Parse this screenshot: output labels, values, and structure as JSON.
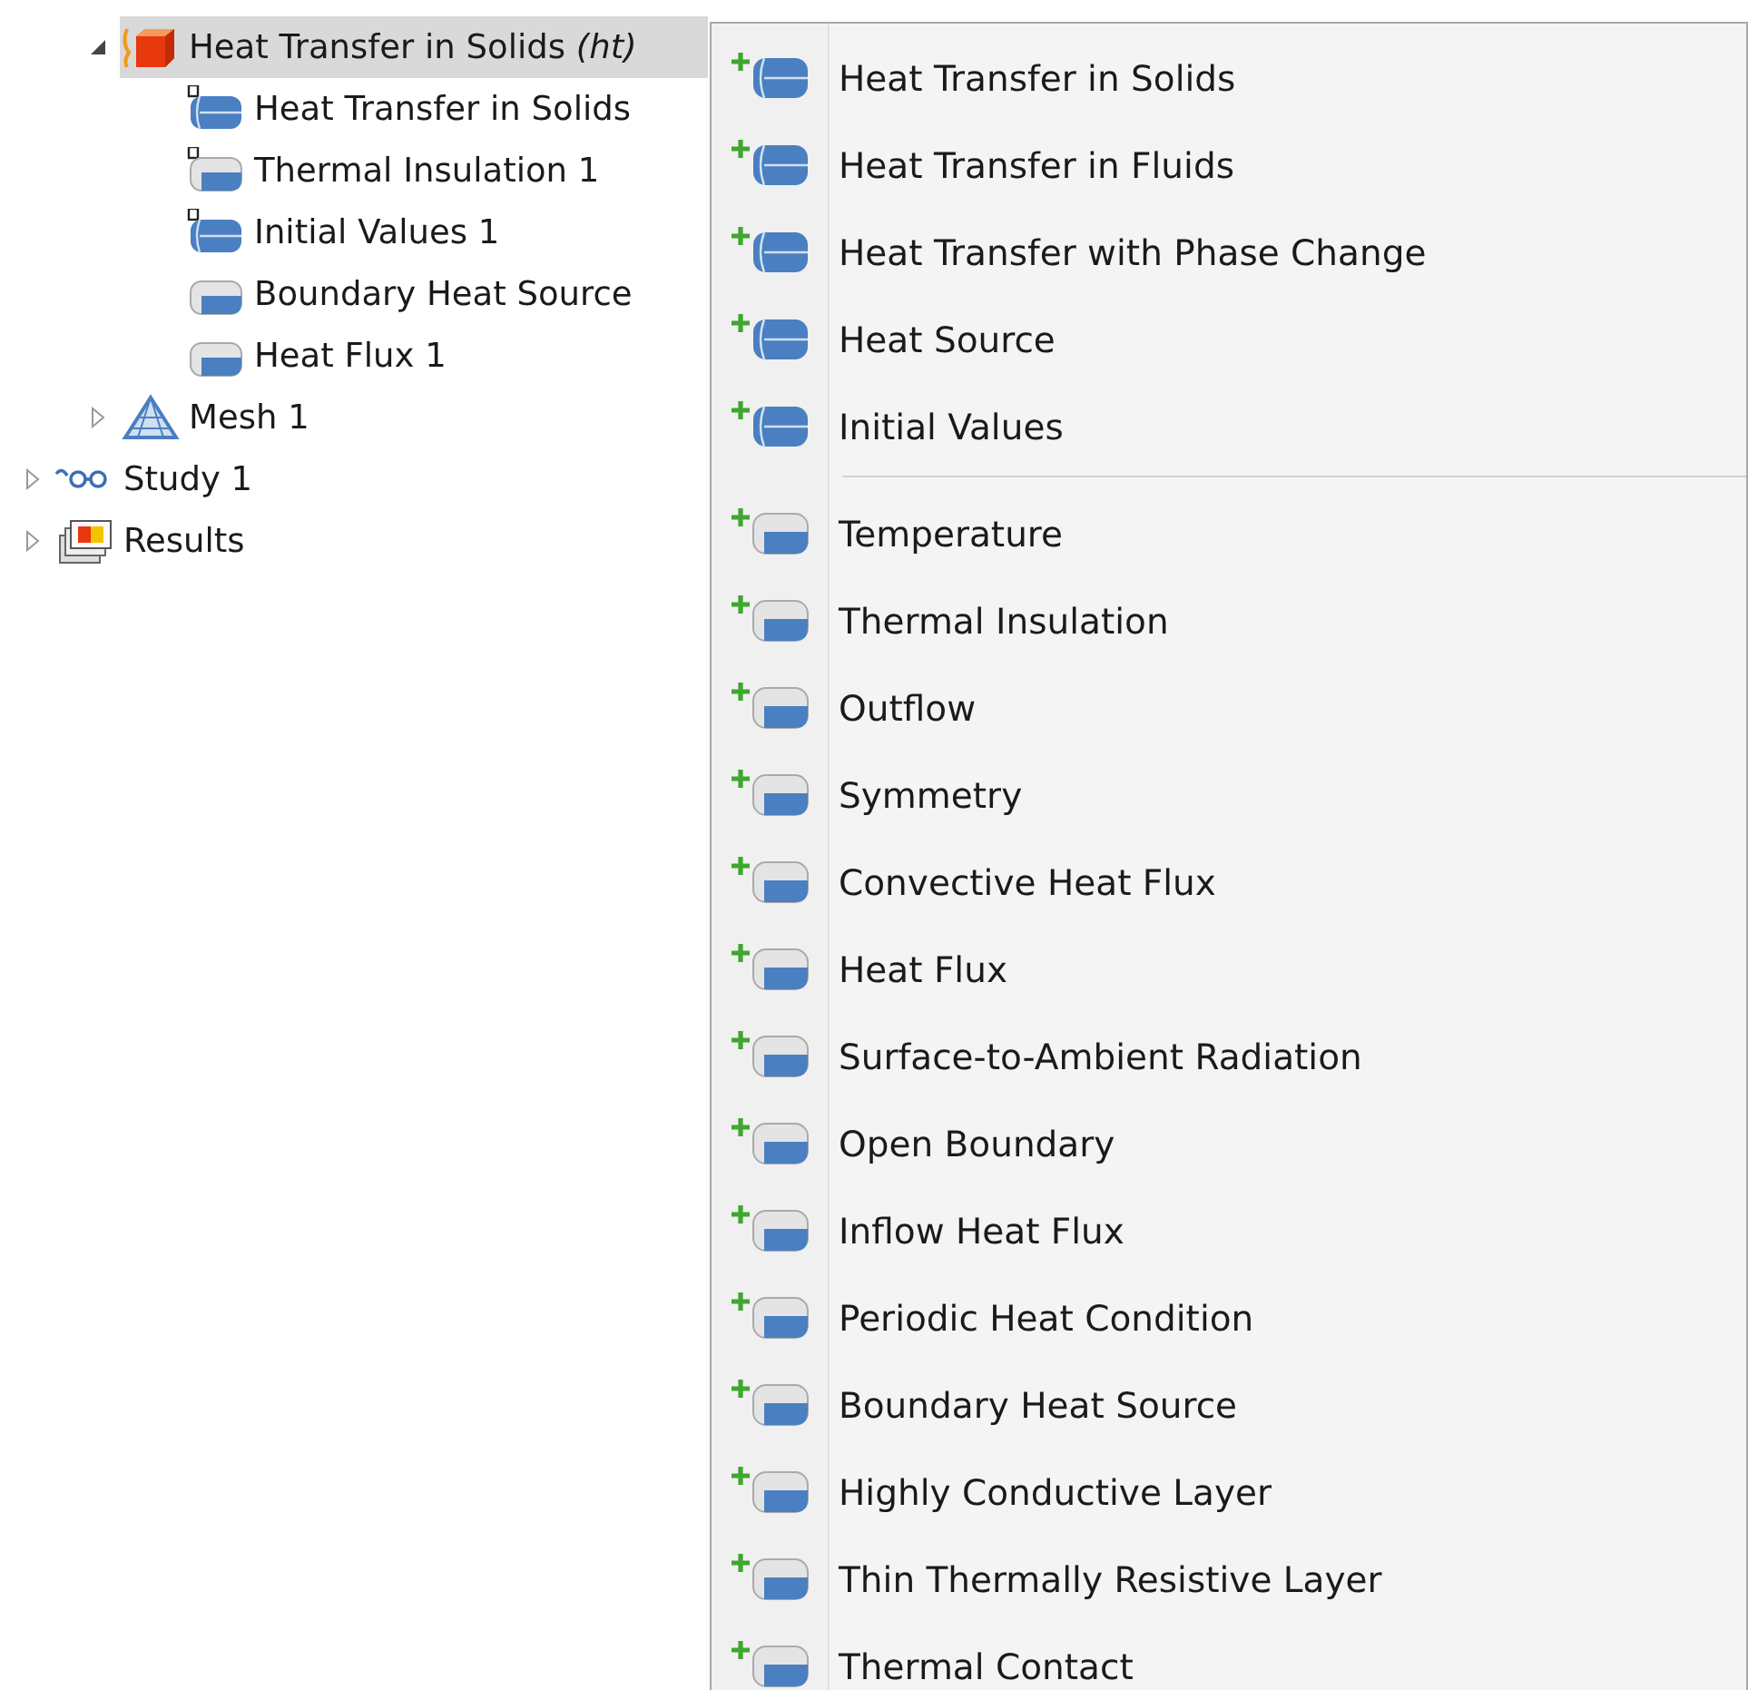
{
  "tree": {
    "inner_items": [
      {
        "label": "Heat Transfer in Solids *(ht)*",
        "kind": "physics",
        "expanded": true,
        "selected": true,
        "children": [
          {
            "label": "Heat Transfer in Solids",
            "kind": "domain",
            "default": true,
            "selected": false
          },
          {
            "label": "Thermal Insulation 1",
            "kind": "boundary",
            "default": true,
            "selected": false
          },
          {
            "label": "Initial Values 1",
            "kind": "domain",
            "default": true,
            "selected": false
          },
          {
            "label": "Boundary Heat Source",
            "kind": "boundary",
            "default": false,
            "selected": false
          },
          {
            "label": "Heat Flux 1",
            "kind": "boundary",
            "default": false,
            "selected": false
          }
        ]
      },
      {
        "label": "Mesh 1",
        "kind": "mesh",
        "expanded": false,
        "selected": false
      }
    ],
    "items": [
      {
        "label": "Study 1",
        "kind": "study",
        "expanded": false,
        "selected": false
      },
      {
        "label": "Results",
        "kind": "results",
        "expanded": false,
        "selected": false
      }
    ]
  },
  "menu": {
    "groups": [
      [
        {
          "label": "Heat Transfer in Solids",
          "kind": "domain"
        },
        {
          "label": "Heat Transfer in Fluids",
          "kind": "domain"
        },
        {
          "label": "Heat Transfer with Phase Change",
          "kind": "domain"
        },
        {
          "label": "Heat Source",
          "kind": "domain"
        },
        {
          "label": "Initial Values",
          "kind": "domain"
        }
      ],
      [
        {
          "label": "Temperature",
          "kind": "boundary"
        },
        {
          "label": "Thermal Insulation",
          "kind": "boundary"
        },
        {
          "label": "Outflow",
          "kind": "boundary"
        },
        {
          "label": "Symmetry",
          "kind": "boundary"
        },
        {
          "label": "Convective Heat Flux",
          "kind": "boundary"
        },
        {
          "label": "Heat Flux",
          "kind": "boundary"
        },
        {
          "label": "Surface-to-Ambient Radiation",
          "kind": "boundary"
        },
        {
          "label": "Open Boundary",
          "kind": "boundary"
        },
        {
          "label": "Inflow Heat Flux",
          "kind": "boundary"
        },
        {
          "label": "Periodic Heat Condition",
          "kind": "boundary"
        },
        {
          "label": "Boundary Heat Source",
          "kind": "boundary"
        },
        {
          "label": "Highly Conductive Layer",
          "kind": "boundary"
        },
        {
          "label": "Thin Thermally Resistive Layer",
          "kind": "boundary"
        },
        {
          "label": "Thermal Contact",
          "kind": "boundary"
        }
      ]
    ]
  }
}
